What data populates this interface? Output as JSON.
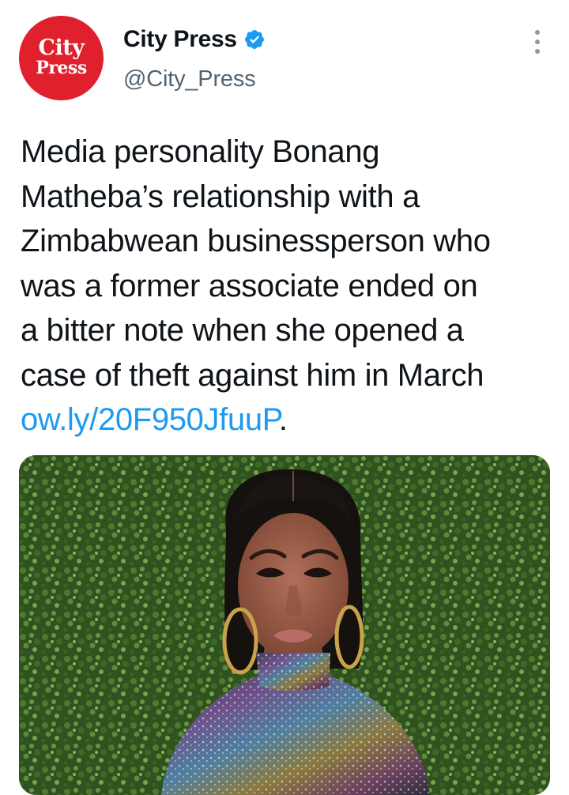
{
  "author": {
    "display_name": "City Press",
    "handle": "@City_Press",
    "verified": true,
    "avatar": {
      "line1": "City",
      "line2": "Press",
      "background": "#e0202c"
    }
  },
  "menu": {
    "icon": "more-vertical-icon"
  },
  "tweet": {
    "lines": [
      "Media personality Bonang",
      "Matheba’s relationship with a",
      "Zimbabwean businessperson who",
      "was a former associate ended on",
      "a bitter note when she opened a",
      "case of theft against him in March"
    ],
    "link_text": "ow.ly/20F950JfuuP",
    "trailing": "."
  },
  "media": {
    "type": "photo"
  },
  "colors": {
    "link": "#1d9bf0",
    "verified": "#1d9bf0",
    "text": "#0f1419",
    "secondary": "#536471"
  }
}
